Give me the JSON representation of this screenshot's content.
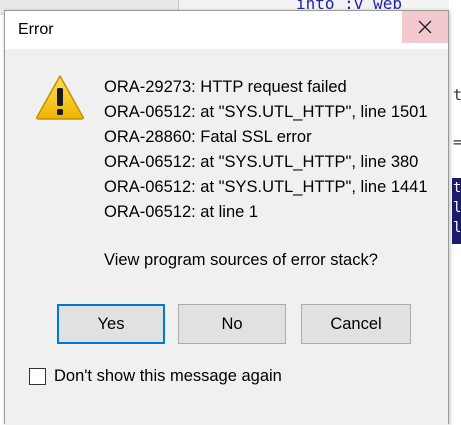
{
  "background": {
    "code_top": "into :v_web",
    "right_fragments": [
      "t",
      "="
    ],
    "selected_fragments": [
      "t",
      "l",
      "l"
    ]
  },
  "dialog": {
    "title": "Error",
    "messages": [
      "ORA-29273: HTTP request failed",
      "ORA-06512: at \"SYS.UTL_HTTP\", line 1501",
      "ORA-28860: Fatal SSL error",
      "ORA-06512: at \"SYS.UTL_HTTP\", line 380",
      "ORA-06512: at \"SYS.UTL_HTTP\", line 1441",
      "ORA-06512: at line 1"
    ],
    "question": "View program sources of error stack?",
    "buttons": {
      "yes": "Yes",
      "no": "No",
      "cancel": "Cancel"
    },
    "checkbox": {
      "label": "Don't show this message again",
      "checked": false
    }
  },
  "icons": {
    "warning": "warning-icon",
    "close": "close-icon"
  },
  "colors": {
    "default_button_border": "#0078d7",
    "close_hover": "#f3c9cf",
    "warning_fill": "#f5c400"
  }
}
